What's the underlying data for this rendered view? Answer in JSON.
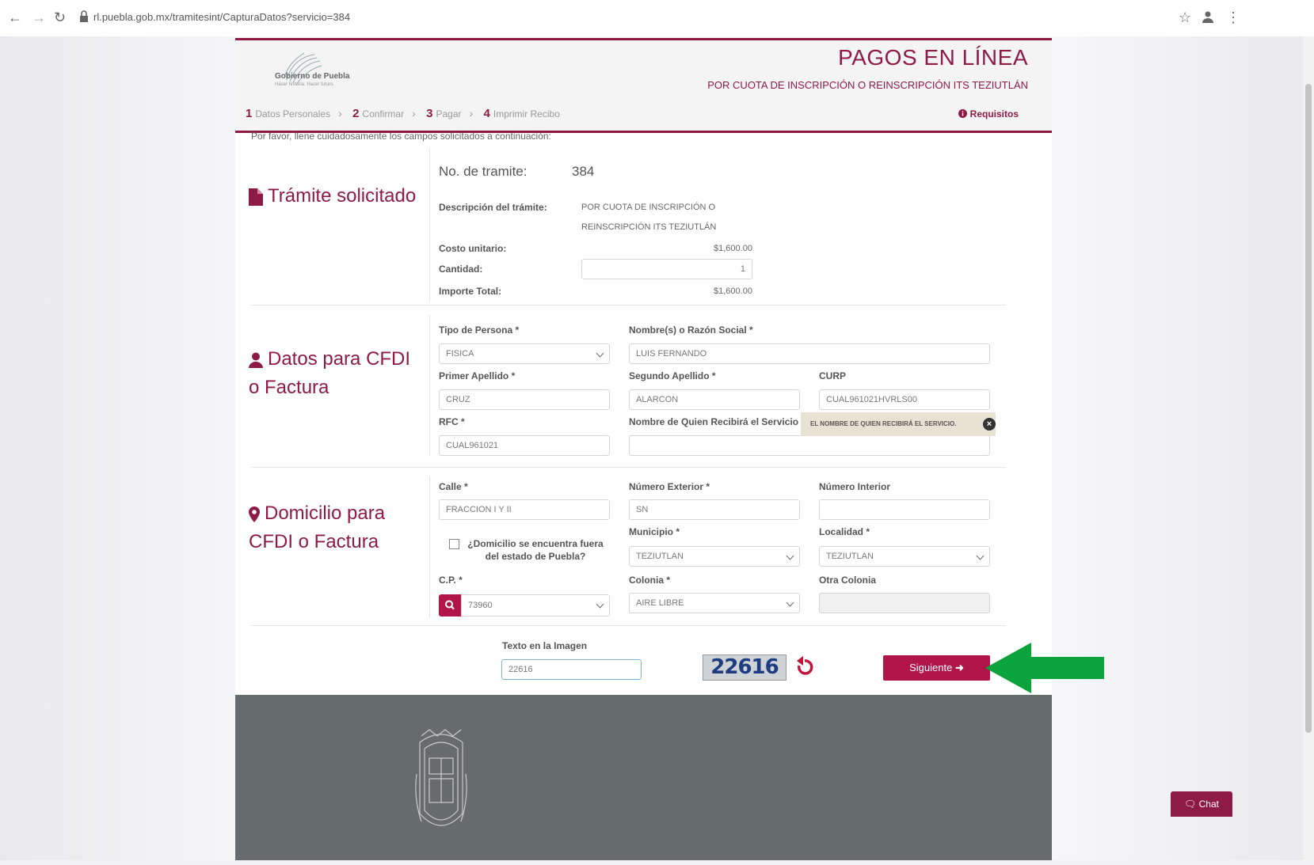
{
  "browser": {
    "url": "rl.puebla.gob.mx/tramitesint/CapturaDatos?servicio=384"
  },
  "header": {
    "logo_text": "Gobierno de Puebla",
    "logo_subtext": "Hacer historia. Hacer futuro.",
    "title": "PAGOS EN LÍNEA",
    "subtitle": "POR CUOTA DE INSCRIPCIÓN O REINSCRIPCIÓN ITS TEZIUTLÁN"
  },
  "steps": [
    {
      "num": "1",
      "label": "Datos Personales"
    },
    {
      "num": "2",
      "label": "Confirmar"
    },
    {
      "num": "3",
      "label": "Pagar"
    },
    {
      "num": "4",
      "label": "Imprimir Recibo"
    }
  ],
  "requisitos": "Requisitos",
  "instructions": "Por favor, llene cuidadosamente los campos solicitados a continuación:",
  "tramite": {
    "section_title": "Trámite solicitado",
    "no_label": "No. de tramite:",
    "no_value": "384",
    "desc_label": "Descripción del trámite:",
    "desc_line1": "POR CUOTA DE INSCRIPCIÓN O",
    "desc_line2": "REINSCRIPCIÓN ITS TEZIUTLÁN",
    "costo_label": "Costo unitario:",
    "costo_value": "$1,600.00",
    "cantidad_label": "Cantidad:",
    "cantidad_value": "1",
    "importe_label": "Importe Total:",
    "importe_value": "$1,600.00"
  },
  "cfdi": {
    "section_title": "Datos para CFDI o Factura",
    "tipo_label": "Tipo de Persona *",
    "tipo_value": "FISICA",
    "nombre_label": "Nombre(s) o Razón Social *",
    "nombre_value": "LUIS FERNANDO",
    "apellido1_label": "Primer Apellido *",
    "apellido1_value": "CRUZ",
    "apellido2_label": "Segundo Apellido *",
    "apellido2_value": "ALARCON",
    "curp_label": "CURP",
    "curp_value": "CUAL961021HVRLS00",
    "rfc_label": "RFC *",
    "rfc_value": "CUAL961021",
    "recibe_label": "Nombre de Quien Recibirá el Servicio",
    "recibe_value": "",
    "tooltip": "EL NOMBRE DE QUIEN RECIBIRÁ EL SERVICIO."
  },
  "domicilio": {
    "section_title": "Domicilio para CFDI o Factura",
    "calle_label": "Calle *",
    "calle_value": "FRACCION I Y II",
    "ext_label": "Número Exterior *",
    "ext_value": "SN",
    "int_label": "Número Interior",
    "int_value": "",
    "fuera_label": "¿Domicilio se encuentra fuera del estado de Puebla?",
    "municipio_label": "Municipio *",
    "municipio_value": "TEZIUTLAN",
    "localidad_label": "Localidad *",
    "localidad_value": "TEZIUTLAN",
    "cp_label": "C.P. *",
    "cp_value": "73960",
    "colonia_label": "Colonia *",
    "colonia_value": "AIRE LIBRE",
    "otra_label": "Otra Colonia",
    "otra_value": ""
  },
  "captcha": {
    "label": "Texto en la Imagen",
    "input_value": "22616",
    "image_text": "22616"
  },
  "next_button": "Siguiente",
  "chat_button": "Chat",
  "colors": {
    "brand": "#8e1b46",
    "button": "#b0164a",
    "arrow": "#0aa33c",
    "footer": "#666b6e"
  }
}
